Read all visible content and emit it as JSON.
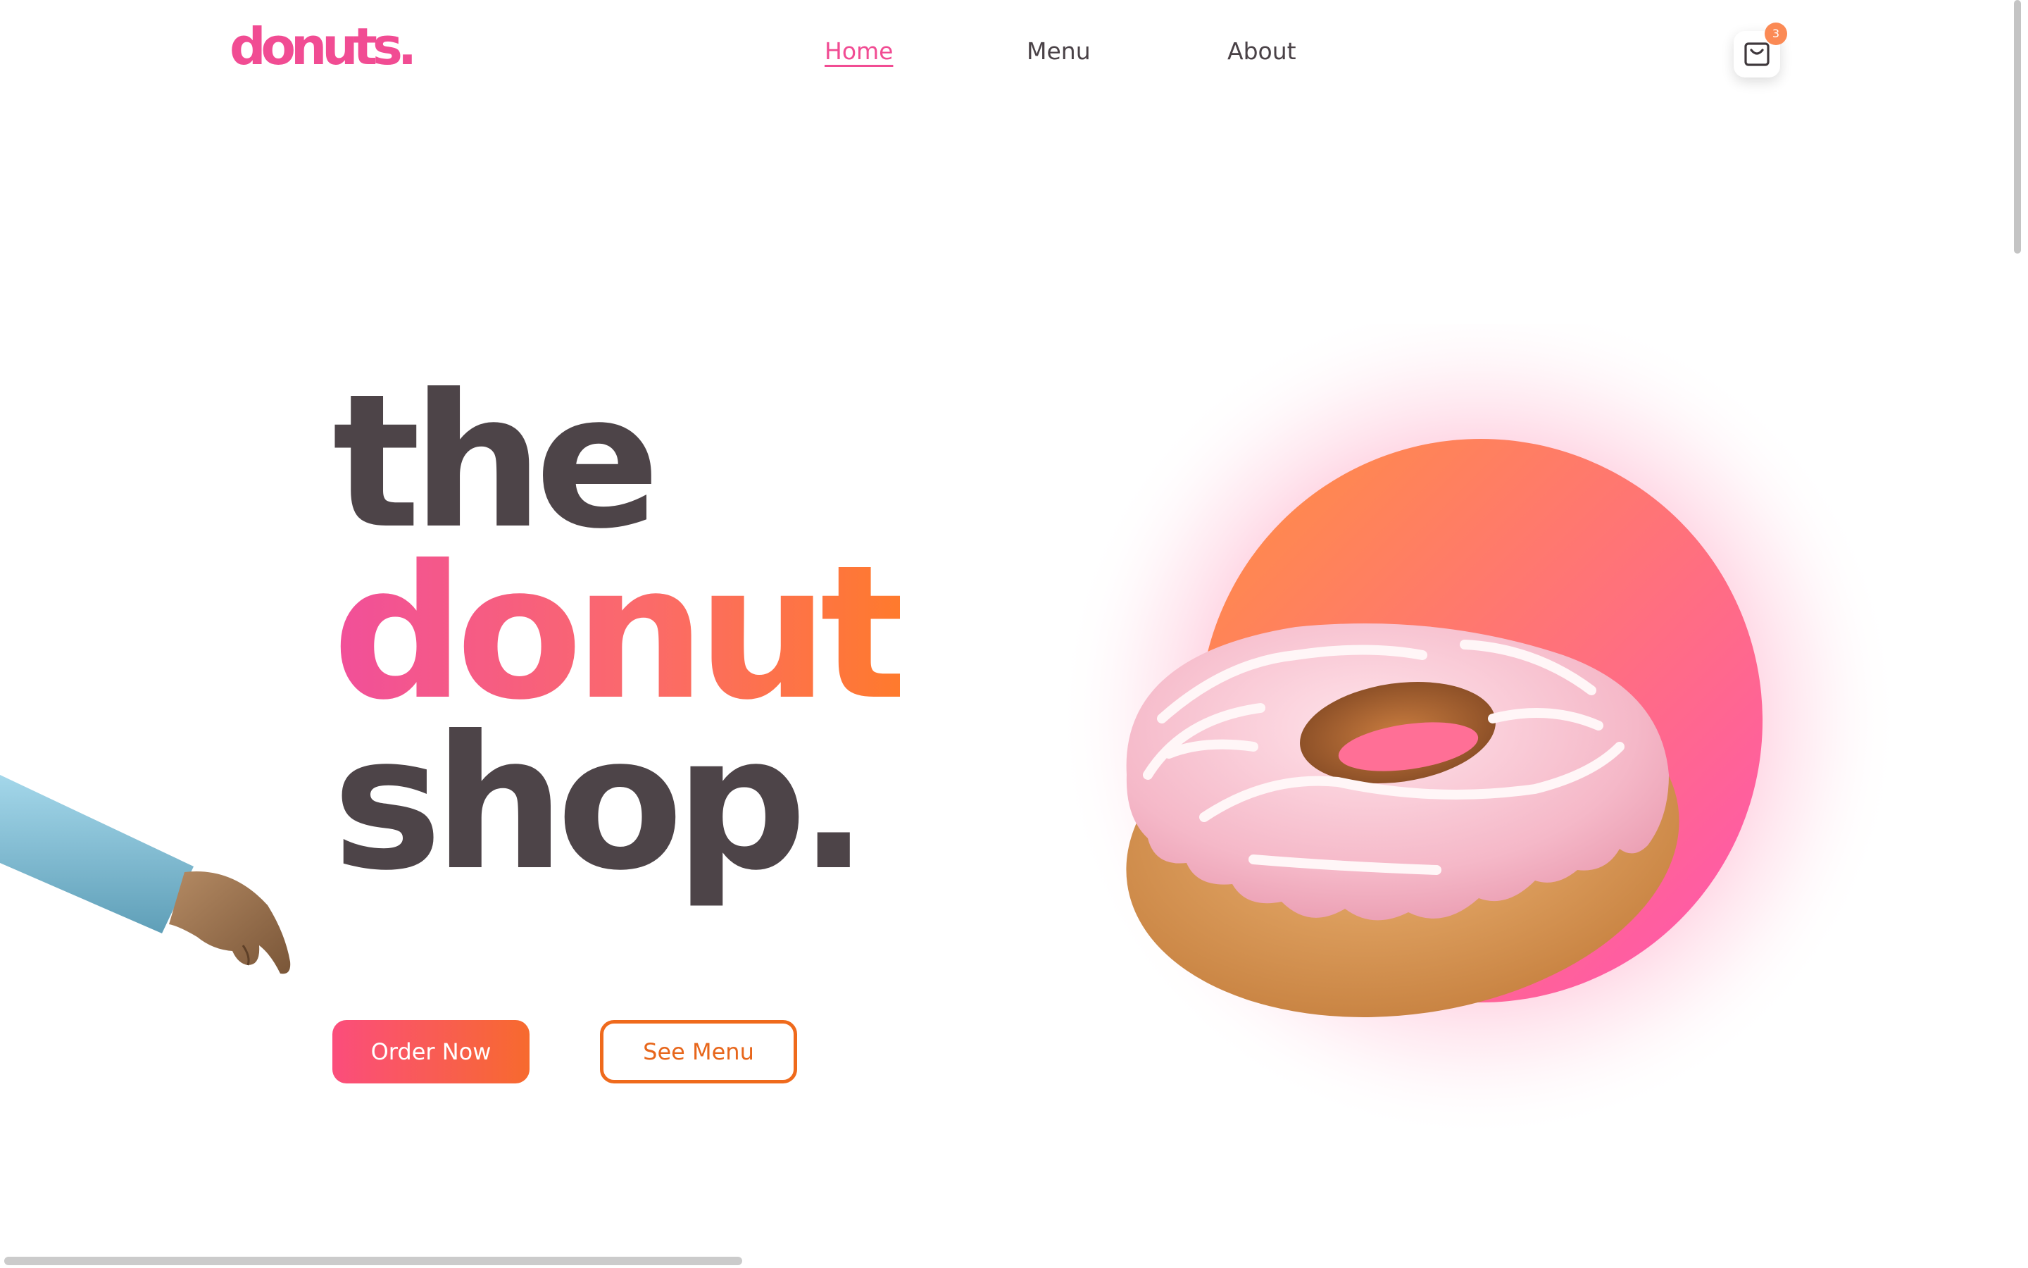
{
  "brand": {
    "logo": "donuts.",
    "color": "#f14c93"
  },
  "nav": {
    "items": [
      {
        "label": "Home",
        "active": true
      },
      {
        "label": "Menu",
        "active": false
      },
      {
        "label": "About",
        "active": false
      }
    ]
  },
  "cart": {
    "icon": "shopping-bag-icon",
    "count": "3"
  },
  "hero": {
    "line1": "the",
    "line2": "donut",
    "line3": "shop."
  },
  "buttons": {
    "order_now": "Order Now",
    "see_menu": "See Menu"
  },
  "colors": {
    "text_dark": "#4d4448",
    "accent_pink": "#f14c93",
    "accent_orange": "#ff7a2d"
  }
}
